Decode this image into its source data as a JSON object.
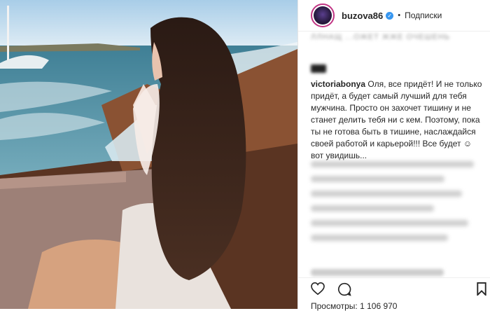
{
  "post": {
    "author": "buzova86",
    "follow_status": "Подписки",
    "icons": [
      "verified-badge-icon",
      "heart-icon",
      "comment-icon",
      "bookmark-icon"
    ]
  },
  "comment": {
    "top_text": "ЛЛНАЩ ...ОЖЕТ ЖЖЕ ОЧЕШЕНЬ",
    "username": "victoriabonya",
    "text": "Оля, все придёт! И не только придёт, а будет самый лучший для тебя мужчина. Просто он захочет тишину и не станет делить тебя ни с кем. Поэтому, пока ты не готова быть в тишине, наслаждайся своей работой и карьерой!!! Все будет ☺ вот увидишь..."
  },
  "footer": {
    "views_label": "Просмотры: 1 106 970"
  }
}
